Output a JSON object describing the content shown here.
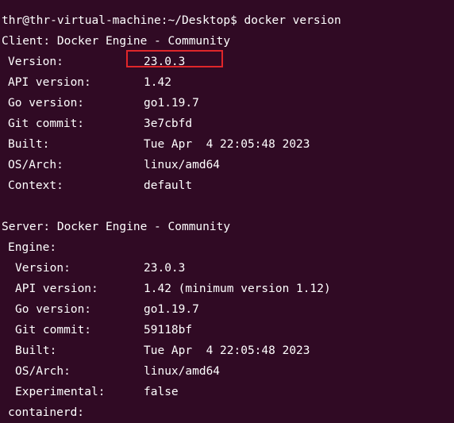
{
  "prompt": {
    "text": "thr@thr-virtual-machine:~/Desktop$ docker version"
  },
  "client": {
    "header": "Client: Docker Engine - Community",
    "rows": [
      {
        "key": "Version:",
        "value": "23.0.3"
      },
      {
        "key": "API version:",
        "value": "1.42"
      },
      {
        "key": "Go version:",
        "value": "go1.19.7"
      },
      {
        "key": "Git commit:",
        "value": "3e7cbfd"
      },
      {
        "key": "Built:",
        "value": "Tue Apr  4 22:05:48 2023"
      },
      {
        "key": "OS/Arch:",
        "value": "linux/amd64"
      },
      {
        "key": "Context:",
        "value": "default"
      }
    ]
  },
  "server": {
    "header": "Server: Docker Engine - Community",
    "engine_label": "Engine:",
    "engine_rows": [
      {
        "key": "Version:",
        "value": "23.0.3"
      },
      {
        "key": "API version:",
        "value": "1.42 (minimum version 1.12)"
      },
      {
        "key": "Go version:",
        "value": "go1.19.7"
      },
      {
        "key": "Git commit:",
        "value": "59118bf"
      },
      {
        "key": "Built:",
        "value": "Tue Apr  4 22:05:48 2023"
      },
      {
        "key": "OS/Arch:",
        "value": "linux/amd64"
      },
      {
        "key": "Experimental:",
        "value": "false"
      }
    ],
    "containerd_label": "containerd:"
  },
  "colors": {
    "background": "#300a24",
    "foreground": "#ffffff",
    "highlight": "#e0262a"
  }
}
